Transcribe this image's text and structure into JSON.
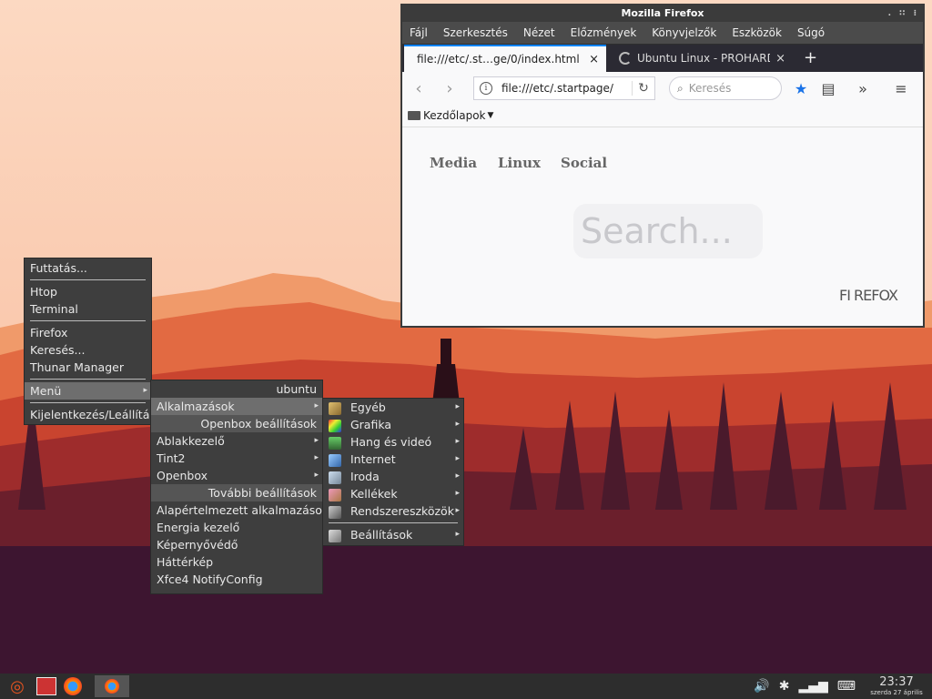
{
  "firefox": {
    "window_title": "Mozilla Firefox",
    "title_controls": ". ∷ ⁝",
    "menus": [
      "Fájl",
      "Szerkesztés",
      "Nézet",
      "Előzmények",
      "Könyvjelzők",
      "Eszközök",
      "Súgó"
    ],
    "tabs": [
      {
        "label": "file:///etc/.st…ge/0/index.html",
        "close": "×"
      },
      {
        "label": "Ubuntu Linux - PROHARD…",
        "close": "×"
      }
    ],
    "new_tab": "+",
    "url": "file:///etc/.startpage/",
    "search_placeholder": "Keresés",
    "bookmark_folder": "Kezdőlapok",
    "startpage": {
      "links": [
        "Media",
        "Linux",
        "Social"
      ],
      "search_text": "Search...",
      "logo": "FI REFOX"
    }
  },
  "main_menu": {
    "items": [
      "Futtatás...",
      "Htop",
      "Terminal",
      "Firefox",
      "Keresés...",
      "Thunar Manager",
      "Menü",
      "Kijelentkezés/Leállítás"
    ]
  },
  "submenu": {
    "header": "ubuntu",
    "apps": "Alkalmazások",
    "openbox_header": "Openbox beállítások",
    "openbox_items": [
      "Ablakkezelő",
      "Tint2",
      "Openbox"
    ],
    "more_header": "További beállítások",
    "more_items": [
      "Alapértelmezett alkalmazások",
      "Energia kezelő",
      "Képernyővédő",
      "Háttérkép",
      "Xfce4 NotifyConfig"
    ]
  },
  "apps_menu": {
    "items": [
      "Egyéb",
      "Grafika",
      "Hang és videó",
      "Internet",
      "Iroda",
      "Kellékek",
      "Rendszereszközök"
    ],
    "settings": "Beállítások"
  },
  "taskbar": {
    "time": "23:37",
    "date": "szerda 27 április"
  },
  "colors": {
    "menu_bg": "#3e3e3e",
    "menu_selected": "#6e6e6e",
    "taskbar_bg": "#2d2d2d",
    "firefox_accent": "#0a84ff"
  }
}
